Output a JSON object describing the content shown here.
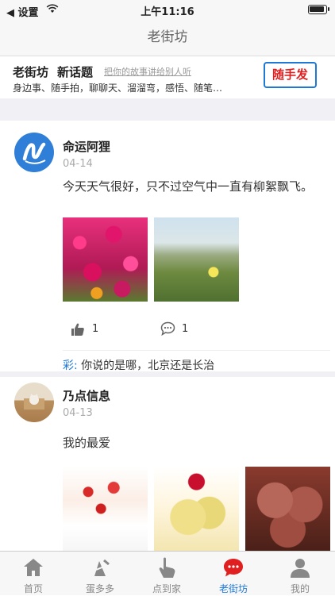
{
  "status_bar": {
    "back_label": "◀ 设置",
    "time": "上午11:16"
  },
  "nav": {
    "title": "老街坊"
  },
  "topic_bar": {
    "title": "老街坊",
    "subtitle": "新话题",
    "hint": "把你的故事讲给别人听",
    "tags": "身边事、随手拍，聊聊天、溜溜弯，感悟、随笔…",
    "post_button": "随手发"
  },
  "posts": [
    {
      "user": "命运阿狸",
      "date": "04-14",
      "content": "今天天气很好，只不过空气中一直有柳絮飘飞。",
      "likes": "1",
      "comments_count": "1",
      "comment": {
        "author": "彩:",
        "text": "你说的是哪，北京还是长治"
      }
    },
    {
      "user": "乃点信息",
      "date": "04-13",
      "content": "我的最爱"
    }
  ],
  "tabbar": {
    "tabs": [
      {
        "label": "首页",
        "icon": "home-icon"
      },
      {
        "label": "蛋多多",
        "icon": "egg-icon"
      },
      {
        "label": "点到家",
        "icon": "tap-icon"
      },
      {
        "label": "老街坊",
        "icon": "chat-icon"
      },
      {
        "label": "我的",
        "icon": "person-icon"
      }
    ],
    "active_color": "#1e78d6",
    "accent_red": "#e02020"
  }
}
